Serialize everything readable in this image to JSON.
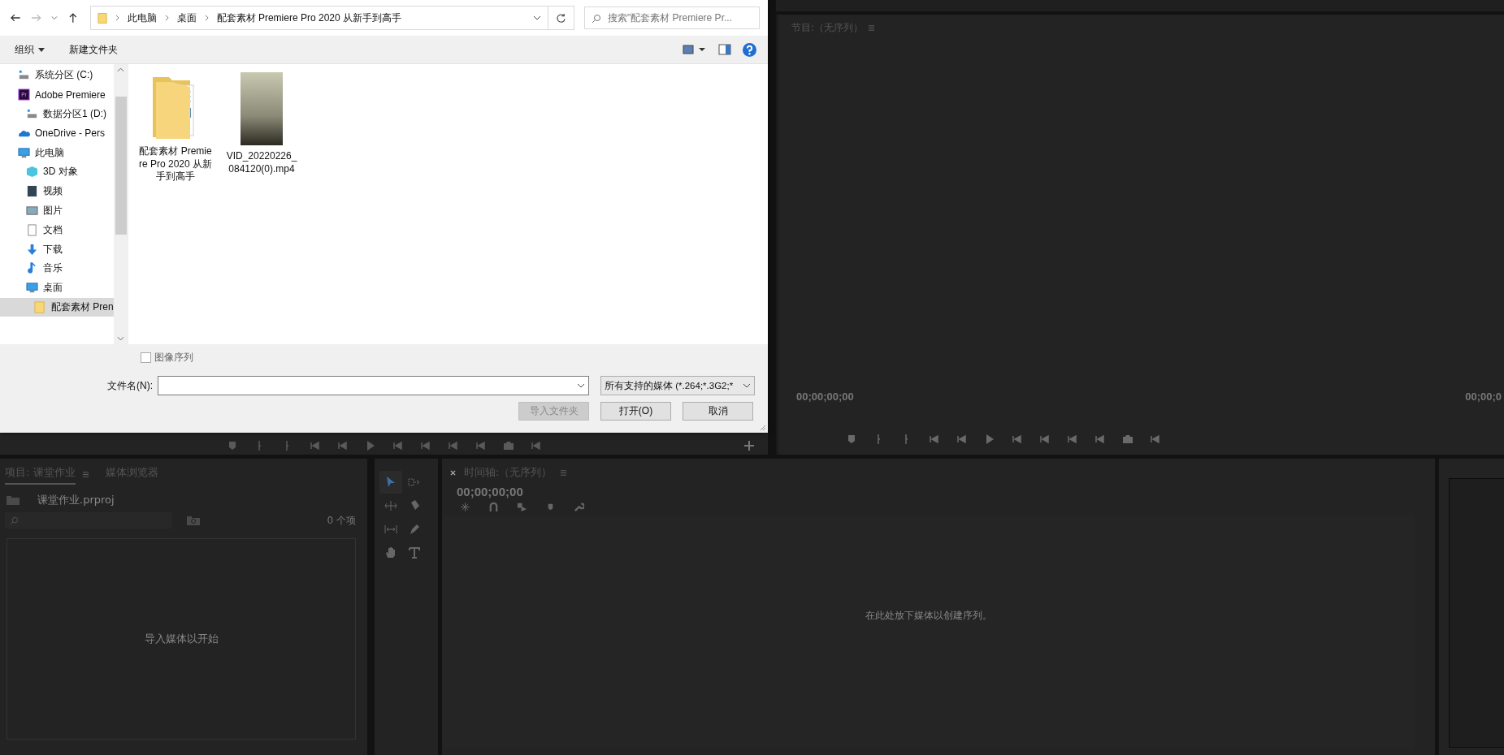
{
  "dialog": {
    "nav": {
      "path": [
        "此电脑",
        "桌面",
        "配套素材 Premiere Pro 2020 从新手到高手"
      ],
      "search_placeholder": "搜索\"配套素材 Premiere Pr..."
    },
    "toolbar": {
      "organize": "组织",
      "new_folder": "新建文件夹"
    },
    "sidebar": {
      "items": [
        {
          "label": "系统分区 (C:)",
          "kind": "drive",
          "selected": false
        },
        {
          "label": "Adobe Premiere",
          "kind": "app",
          "icon_text": "Pr",
          "selected": false,
          "children": [
            {
              "label": "数据分区1 (D:)",
              "kind": "drive",
              "selected": false
            }
          ]
        },
        {
          "label": "OneDrive - Pers",
          "kind": "cloud",
          "selected": false
        },
        {
          "label": "此电脑",
          "kind": "pc",
          "selected": false,
          "children": [
            {
              "label": "3D 对象",
              "kind": "cube",
              "selected": false
            },
            {
              "label": "视频",
              "kind": "video",
              "selected": false
            },
            {
              "label": "图片",
              "kind": "pictures",
              "selected": false
            },
            {
              "label": "文档",
              "kind": "documents",
              "selected": false
            },
            {
              "label": "下载",
              "kind": "downloads",
              "selected": false
            },
            {
              "label": "音乐",
              "kind": "music",
              "selected": false
            },
            {
              "label": "桌面",
              "kind": "desktop",
              "selected": false,
              "children": [
                {
                  "label": "配套素材 Pren",
                  "kind": "folder",
                  "selected": true
                }
              ]
            }
          ]
        }
      ]
    },
    "files": [
      {
        "kind": "folder",
        "name": "配套素材 Premiere Pro 2020 从新手到高手"
      },
      {
        "kind": "video",
        "name": "VID_20220226_084120(0).mp4"
      }
    ],
    "image_sequence": {
      "label": "图像序列",
      "checked": false
    },
    "filename_label": "文件名(N):",
    "filetype": "所有支持的媒体 (*.264;*.3G2;*",
    "buttons": [
      {
        "label": "导入文件夹",
        "disabled": true
      },
      {
        "label": "打开(O)",
        "disabled": false
      },
      {
        "label": "取消",
        "disabled": false
      }
    ]
  },
  "program_monitor": {
    "title": "节目:（无序列）",
    "timecode_in": "00;00;00;00",
    "timecode_out": "00;00;0"
  },
  "project": {
    "tabs": [
      {
        "label": "项目: 课堂作业",
        "selected": true
      },
      {
        "label": "媒体浏览器",
        "selected": false
      }
    ],
    "file": "课堂作业.prproj",
    "count": "0 个项",
    "empty_message": "导入媒体以开始"
  },
  "tools": [
    {
      "kind": "select",
      "selected": true
    },
    {
      "kind": "track-select",
      "selected": false
    },
    {
      "kind": "ripple",
      "selected": false
    },
    {
      "kind": "razor",
      "selected": false
    },
    {
      "kind": "slip",
      "selected": false
    },
    {
      "kind": "pen",
      "selected": false
    },
    {
      "kind": "hand",
      "selected": false
    },
    {
      "kind": "type",
      "selected": false
    }
  ],
  "timeline": {
    "title": "时间轴:（无序列）",
    "timecode": "00;00;00;00",
    "empty_message": "在此处放下媒体以创建序列。"
  }
}
